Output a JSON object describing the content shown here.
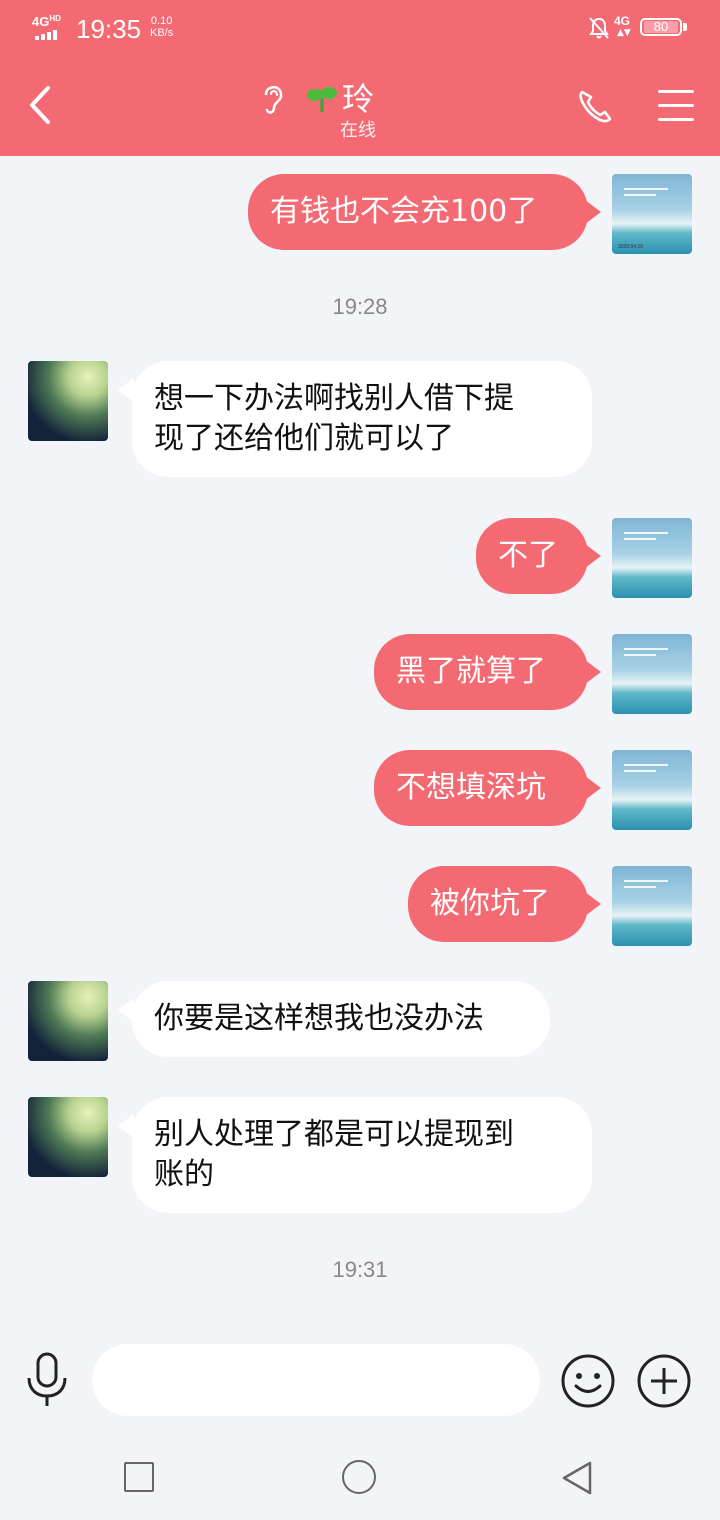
{
  "status_bar": {
    "network": "4G",
    "network_hd": "HD",
    "time": "19:35",
    "speed_value": "0.10",
    "speed_unit": "KB/s",
    "signal_label": "4G",
    "battery": "80"
  },
  "header": {
    "title": "玲",
    "subtitle": "在线",
    "icons": [
      "back-arrow-icon",
      "ear-icon",
      "sprout-icon",
      "phone-icon",
      "menu-icon"
    ]
  },
  "messages": [
    {
      "side": "me",
      "text": "有钱也不会充100了"
    },
    {
      "type": "timestamp",
      "text": "19:28"
    },
    {
      "side": "her",
      "line1": "想一下办法啊找别人借下提",
      "line2": "现了还给他们就可以了"
    },
    {
      "side": "me",
      "text": "不了"
    },
    {
      "side": "me",
      "text": "黑了就算了"
    },
    {
      "side": "me",
      "text": "不想填深坑"
    },
    {
      "side": "me",
      "text": "被你坑了"
    },
    {
      "side": "her",
      "text": "你要是这样想我也没办法"
    },
    {
      "side": "her",
      "line1": "别人处理了都是可以提现到",
      "line2": "账的"
    },
    {
      "type": "timestamp",
      "text": "19:31"
    }
  ],
  "avatar_me_caption": "2020.04.10",
  "input_bar": {
    "placeholder": "",
    "icons": [
      "mic-icon",
      "emoji-icon",
      "plus-icon"
    ]
  },
  "colors": {
    "accent": "#f46a73",
    "background": "#f3f4f8",
    "bubble_other": "#ffffff"
  }
}
